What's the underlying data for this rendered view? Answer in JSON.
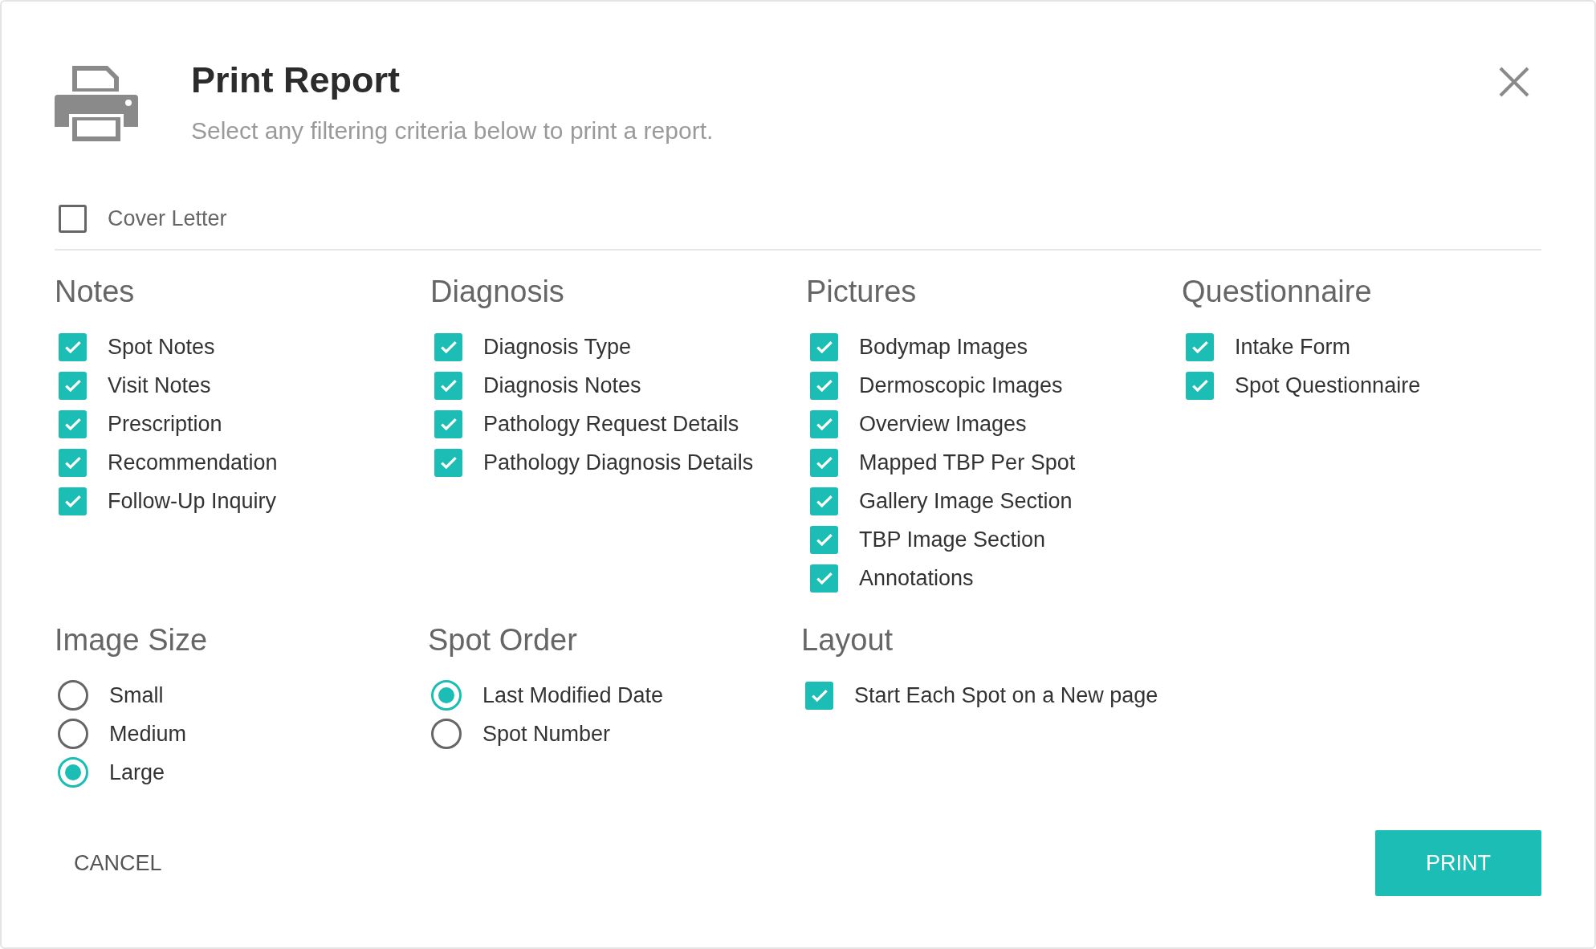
{
  "dialog": {
    "title": "Print Report",
    "subtitle": "Select any filtering criteria below to print a report."
  },
  "cover_letter": {
    "label": "Cover Letter",
    "checked": false
  },
  "sections": [
    {
      "title": "Notes",
      "items": [
        {
          "label": "Spot Notes",
          "checked": true
        },
        {
          "label": "Visit Notes",
          "checked": true
        },
        {
          "label": "Prescription",
          "checked": true
        },
        {
          "label": "Recommendation",
          "checked": true
        },
        {
          "label": "Follow-Up Inquiry",
          "checked": true
        }
      ]
    },
    {
      "title": "Diagnosis",
      "items": [
        {
          "label": "Diagnosis Type",
          "checked": true
        },
        {
          "label": "Diagnosis Notes",
          "checked": true
        },
        {
          "label": "Pathology Request Details",
          "checked": true
        },
        {
          "label": "Pathology Diagnosis Details",
          "checked": true
        }
      ]
    },
    {
      "title": "Pictures",
      "items": [
        {
          "label": "Bodymap Images",
          "checked": true
        },
        {
          "label": "Dermoscopic Images",
          "checked": true
        },
        {
          "label": "Overview Images",
          "checked": true
        },
        {
          "label": "Mapped TBP Per Spot",
          "checked": true
        },
        {
          "label": "Gallery Image Section",
          "checked": true
        },
        {
          "label": "TBP Image Section",
          "checked": true
        },
        {
          "label": "Annotations",
          "checked": true
        }
      ]
    },
    {
      "title": "Questionnaire",
      "items": [
        {
          "label": "Intake Form",
          "checked": true
        },
        {
          "label": "Spot Questionnaire",
          "checked": true
        }
      ]
    }
  ],
  "options": [
    {
      "title": "Image Size",
      "kind": "radio",
      "items": [
        {
          "label": "Small",
          "selected": false
        },
        {
          "label": "Medium",
          "selected": false
        },
        {
          "label": "Large",
          "selected": true
        }
      ]
    },
    {
      "title": "Spot Order",
      "kind": "radio",
      "items": [
        {
          "label": "Last Modified Date",
          "selected": true
        },
        {
          "label": "Spot Number",
          "selected": false
        }
      ]
    },
    {
      "title": "Layout",
      "kind": "checkbox",
      "items": [
        {
          "label": "Start Each Spot on a New page",
          "checked": true
        }
      ]
    }
  ],
  "buttons": {
    "cancel": "CANCEL",
    "print": "PRINT"
  }
}
